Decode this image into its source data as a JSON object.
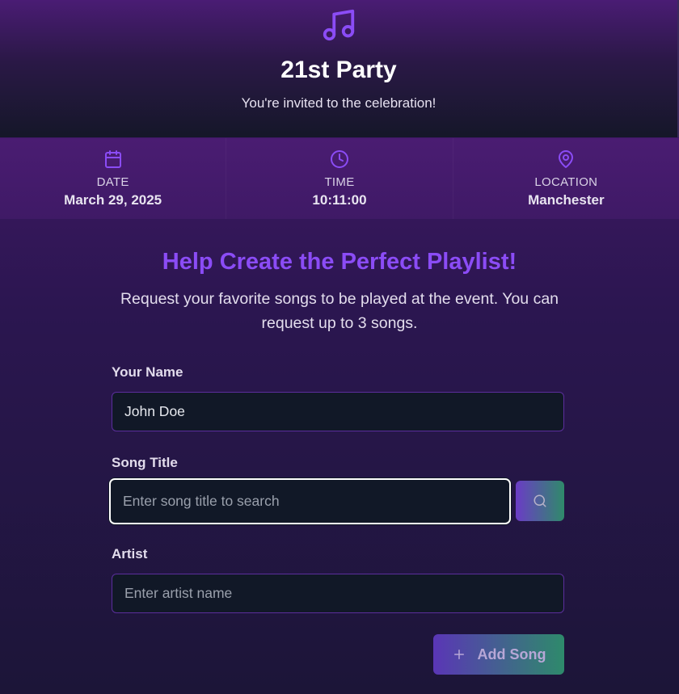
{
  "header": {
    "icon": "music-note-icon",
    "title": "21st Party",
    "subtitle": "You're invited to the celebration!"
  },
  "info": {
    "date": {
      "icon": "calendar-icon",
      "label": "DATE",
      "value": "March 29, 2025"
    },
    "time": {
      "icon": "clock-icon",
      "label": "TIME",
      "value": "10:11:00"
    },
    "location": {
      "icon": "map-pin-icon",
      "label": "LOCATION",
      "value": "Manchester"
    }
  },
  "playlist": {
    "title": "Help Create the Perfect Playlist!",
    "description": "Request your favorite songs to be played at the event. You can request up to 3 songs."
  },
  "form": {
    "name": {
      "label": "Your Name",
      "value": "John Doe",
      "placeholder": ""
    },
    "song": {
      "label": "Song Title",
      "value": "",
      "placeholder": "Enter song title to search"
    },
    "artist": {
      "label": "Artist",
      "value": "",
      "placeholder": "Enter artist name"
    },
    "search_button": {
      "icon": "search-icon"
    },
    "add_button": {
      "icon": "plus-icon",
      "label": "Add Song"
    }
  },
  "colors": {
    "accent": "#8b4cf6",
    "input_bg": "#111827",
    "gradient_start": "#6b3cc6",
    "gradient_end": "#2f8a6a"
  }
}
